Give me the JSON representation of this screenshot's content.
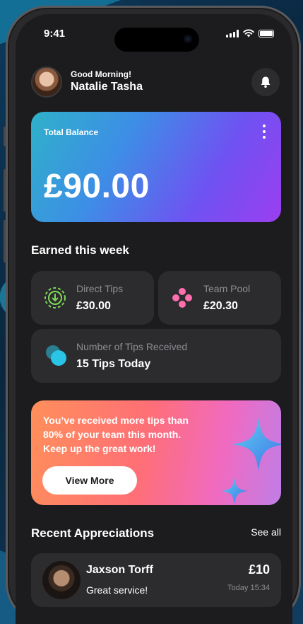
{
  "status_bar": {
    "time": "9:41"
  },
  "header": {
    "greeting": "Good Morning!",
    "user_name": "Natalie Tasha"
  },
  "balance_card": {
    "label": "Total Balance",
    "amount": "£90.00"
  },
  "earned": {
    "title": "Earned this week",
    "direct_tips": {
      "label": "Direct Tips",
      "value": "£30.00"
    },
    "team_pool": {
      "label": "Team Pool",
      "value": "£20.30"
    },
    "tips_received": {
      "label": "Number of Tips Received",
      "value": "15 Tips Today"
    }
  },
  "promo": {
    "line1": "You’ve received more tips than",
    "line2": "80% of your team this month.",
    "line3": "Keep up the great work!",
    "button": "View More"
  },
  "recent": {
    "title": "Recent Appreciations",
    "see_all": "See all",
    "items": [
      {
        "name": "Jaxson Torff",
        "message": "Great service!",
        "amount": "£10",
        "time": "Today 15:34"
      }
    ]
  },
  "colors": {
    "accent_teal": "#2fb1c9",
    "accent_purple": "#9b3ef0",
    "direct_tips_icon": "#7ed957",
    "team_pool_icon": "#ff6fae",
    "tips_icon": "#29c4e6"
  },
  "icons": [
    "bell-icon",
    "kebab-menu-icon",
    "download-circle-icon",
    "team-dots-icon",
    "tips-coins-icon",
    "sparkle-icon"
  ]
}
